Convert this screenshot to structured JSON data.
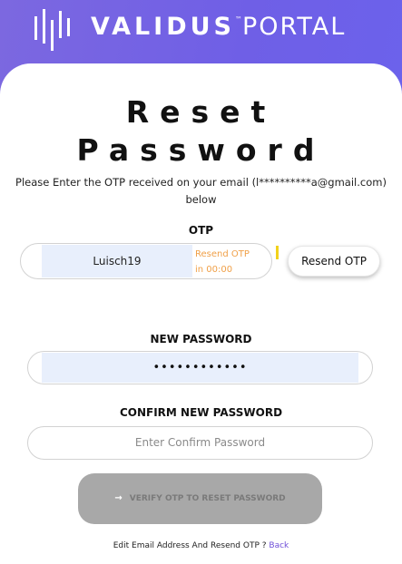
{
  "brand": {
    "name": "VALIDUS",
    "trademark": "™",
    "product": "PORTAL"
  },
  "page": {
    "title_line1": "Reset",
    "title_line2": "Password",
    "instruction": "Please Enter the OTP received on your email (l**********a@gmail.com) below"
  },
  "otp": {
    "label": "OTP",
    "value": "Luisch19",
    "timer_line1": "Resend OTP",
    "timer_line2": "in 00:00",
    "resend_label": "Resend OTP"
  },
  "new_password": {
    "label": "NEW PASSWORD",
    "masked_value": "••••••••••••"
  },
  "confirm_password": {
    "label": "CONFIRM NEW PASSWORD",
    "placeholder": "Enter Confirm Password"
  },
  "verify_button": {
    "label": "VERIFY OTP TO RESET PASSWORD",
    "icon": "arrow-right-icon"
  },
  "footer": {
    "text": "Edit Email Address And Resend OTP ? ",
    "back_link": "Back"
  },
  "colors": {
    "header_gradient_start": "#7c68e0",
    "header_gradient_end": "#6a63ee",
    "otp_input_bg": "#e8effc",
    "timer_text": "#f0a048",
    "disabled_button": "#a8a8a8",
    "back_link": "#6f4fd8"
  }
}
